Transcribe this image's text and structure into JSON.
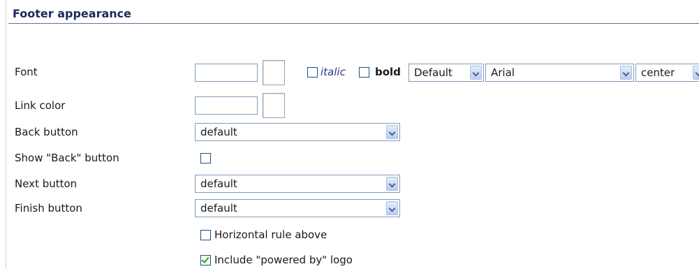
{
  "section": {
    "title": "Footer appearance"
  },
  "rows": {
    "font": {
      "label": "Font",
      "italic_label": "italic",
      "bold_label": "bold",
      "size_value": "Default",
      "family_value": "Arial",
      "align_value": "center",
      "italic_checked": false,
      "bold_checked": false
    },
    "link_color": {
      "label": "Link color"
    },
    "back_button": {
      "label": "Back button",
      "value": "default"
    },
    "show_back": {
      "label": "Show \"Back\" button",
      "checked": false
    },
    "next_button": {
      "label": "Next button",
      "value": "default"
    },
    "finish_button": {
      "label": "Finish button",
      "value": "default"
    },
    "horizontal_rule": {
      "label": "Horizontal rule above",
      "checked": false
    },
    "powered_by": {
      "label": "Include \"powered by\" logo",
      "checked": true
    }
  },
  "colors": {
    "title": "#1d2a5a",
    "rule": "#6b6b9a",
    "field_border": "#7f9db9",
    "check_mark": "#21a121"
  }
}
